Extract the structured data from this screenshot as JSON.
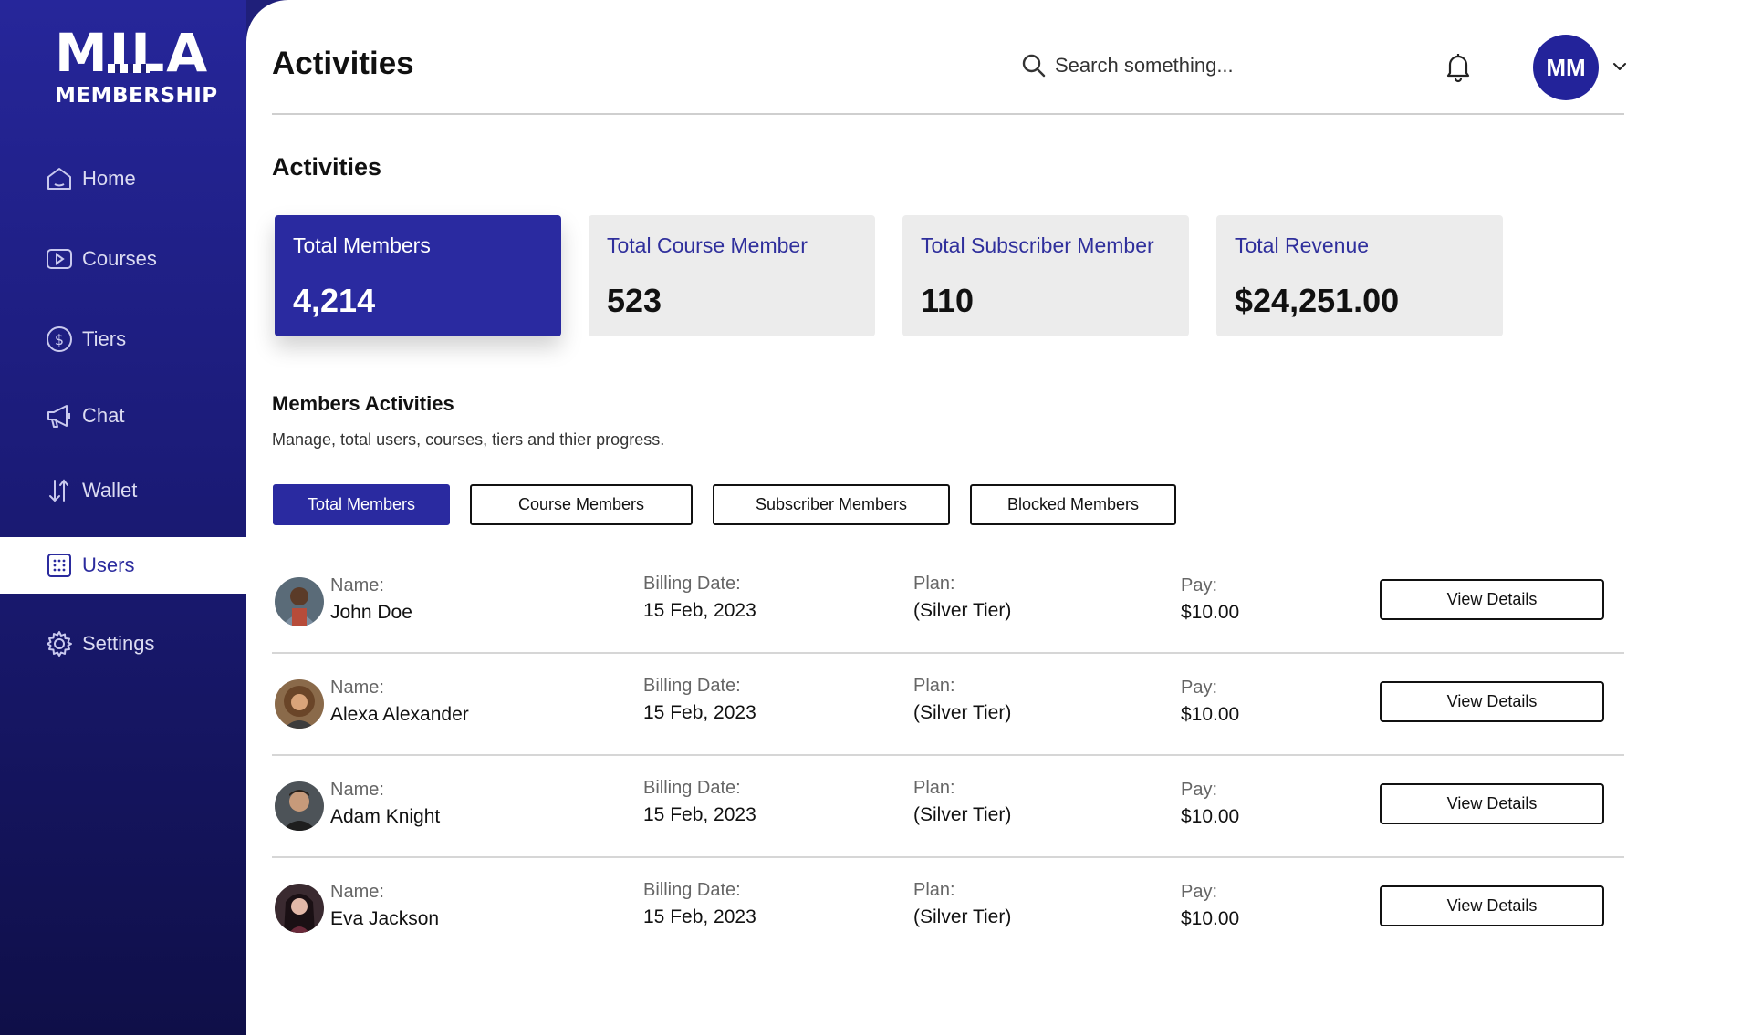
{
  "brand": {
    "logo_word": "MILA",
    "logo_sub": "MEMBERSHIP"
  },
  "sidebar": {
    "items": [
      {
        "label": "Home",
        "icon": "home-icon",
        "active": false
      },
      {
        "label": "Courses",
        "icon": "play-icon",
        "active": false
      },
      {
        "label": "Tiers",
        "icon": "dollar-circle-icon",
        "active": false
      },
      {
        "label": "Chat",
        "icon": "megaphone-icon",
        "active": false
      },
      {
        "label": "Wallet",
        "icon": "sort-arrows-icon",
        "active": false
      },
      {
        "label": "Users",
        "icon": "users-grid-icon",
        "active": true
      },
      {
        "label": "Settings",
        "icon": "gear-icon",
        "active": false
      }
    ]
  },
  "header": {
    "title": "Activities",
    "search_placeholder": "Search something...",
    "avatar_initials": "MM"
  },
  "activities": {
    "title": "Activities",
    "cards": [
      {
        "label": "Total Members",
        "value": "4,214",
        "highlighted": true
      },
      {
        "label": "Total Course Member",
        "value": "523",
        "highlighted": false
      },
      {
        "label": "Total Subscriber Member",
        "value": "110",
        "highlighted": false
      },
      {
        "label": "Total Revenue",
        "value": "$24,251.00",
        "highlighted": false
      }
    ]
  },
  "members": {
    "title": "Members Activities",
    "subtitle": "Manage, total users, courses, tiers and thier progress.",
    "tabs": [
      "Total Members",
      "Course Members",
      "Subscriber Members",
      "Blocked Members"
    ],
    "active_tab": 0,
    "labels": {
      "name": "Name:",
      "billing": "Billing Date:",
      "plan": "Plan:",
      "pay": "Pay:",
      "action": "View Details"
    },
    "rows": [
      {
        "name": "John Doe",
        "billing_date": "15 Feb, 2023",
        "plan": "(Silver Tier)",
        "pay": "$10.00"
      },
      {
        "name": "Alexa Alexander",
        "billing_date": "15 Feb, 2023",
        "plan": "(Silver Tier)",
        "pay": "$10.00"
      },
      {
        "name": "Adam Knight",
        "billing_date": "15 Feb, 2023",
        "plan": "(Silver Tier)",
        "pay": "$10.00"
      },
      {
        "name": "Eva Jackson",
        "billing_date": "15 Feb, 2023",
        "plan": "(Silver Tier)",
        "pay": "$10.00"
      }
    ]
  },
  "colors": {
    "brand": "#2a2aa0",
    "sidebar_top": "#26269a",
    "sidebar_bottom": "#0f0f48",
    "card_bg": "#ececec"
  }
}
